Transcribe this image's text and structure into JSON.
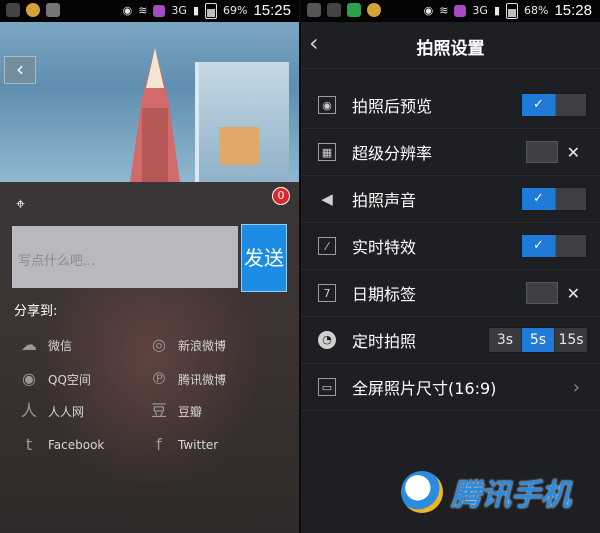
{
  "left": {
    "status": {
      "battery_pct": "69%",
      "network": "3G",
      "time": "15:25"
    },
    "send_label": "发送",
    "input_placeholder": "写点什么吧...",
    "badge": "0",
    "share_to": "分享到:",
    "share_items": [
      {
        "label": "微信",
        "icon": "wechat-icon"
      },
      {
        "label": "新浪微博",
        "icon": "weibo-icon"
      },
      {
        "label": "QQ空间",
        "icon": "qzone-icon"
      },
      {
        "label": "腾讯微博",
        "icon": "tencent-weibo-icon"
      },
      {
        "label": "人人网",
        "icon": "renren-icon"
      },
      {
        "label": "豆瓣",
        "icon": "douban-icon"
      },
      {
        "label": "Facebook",
        "icon": "facebook-icon"
      },
      {
        "label": "Twitter",
        "icon": "twitter-icon"
      }
    ]
  },
  "right": {
    "status": {
      "battery_pct": "68%",
      "network": "3G",
      "time": "15:28"
    },
    "title": "拍照设置",
    "settings": [
      {
        "label": "拍照后预览",
        "icon": "eye-icon",
        "state": "on"
      },
      {
        "label": "超级分辨率",
        "icon": "resolution-icon",
        "state": "off"
      },
      {
        "label": "拍照声音",
        "icon": "speaker-icon",
        "state": "on"
      },
      {
        "label": "实时特效",
        "icon": "magic-wand-icon",
        "state": "on"
      },
      {
        "label": "日期标签",
        "icon": "calendar-icon",
        "state": "off",
        "calendar_num": "7"
      },
      {
        "label": "定时拍照",
        "icon": "clock-icon",
        "timer_options": [
          "3s",
          "5s",
          "15s"
        ],
        "timer_selected": "5s"
      },
      {
        "label": "全屏照片尺寸(16:9)",
        "icon": "aspect-ratio-icon"
      }
    ],
    "toggle_check": "✓",
    "toggle_off": "✕",
    "watermark": "腾讯手机"
  },
  "colors": {
    "accent": "#1f7ad8",
    "send": "#1c8ce4",
    "badge": "#e02727"
  }
}
